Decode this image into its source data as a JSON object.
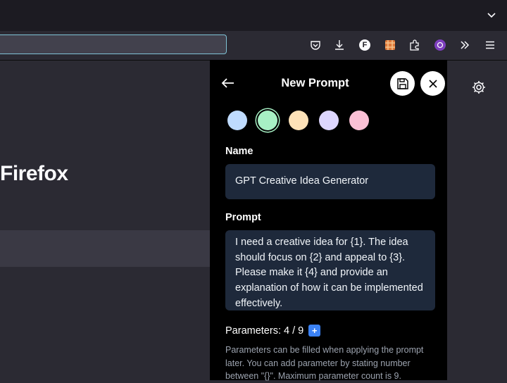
{
  "browser": {
    "page_heading": "Firefox",
    "toolbar_icons": [
      "pocket-icon",
      "download-icon",
      "extension-f-icon",
      "extension-grid-icon",
      "extensions-puzzle-icon",
      "extension-purple-icon",
      "overflow-chevrons-icon",
      "menu-icon"
    ],
    "extension_f_letter": "F"
  },
  "panel": {
    "title": "New Prompt",
    "colors": [
      "#bfdbfe",
      "#a7f0c4",
      "#fde2b8",
      "#ddd6fe",
      "#fbc0d5"
    ],
    "selected_color_index": 1,
    "name_label": "Name",
    "name_value": "GPT Creative Idea Generator",
    "prompt_label": "Prompt",
    "prompt_value": "I need a creative idea for {1}. The idea should focus on {2} and appeal to {3}. Please make it {4} and provide an explanation of how it can be implemented effectively.",
    "parameters_text": "Parameters: 4 / 9",
    "add_parameter_label": "+",
    "help_text": "Parameters can be filled when applying the prompt later. You can add parameter by stating number between \"{}\". Maximum parameter count is 9."
  }
}
